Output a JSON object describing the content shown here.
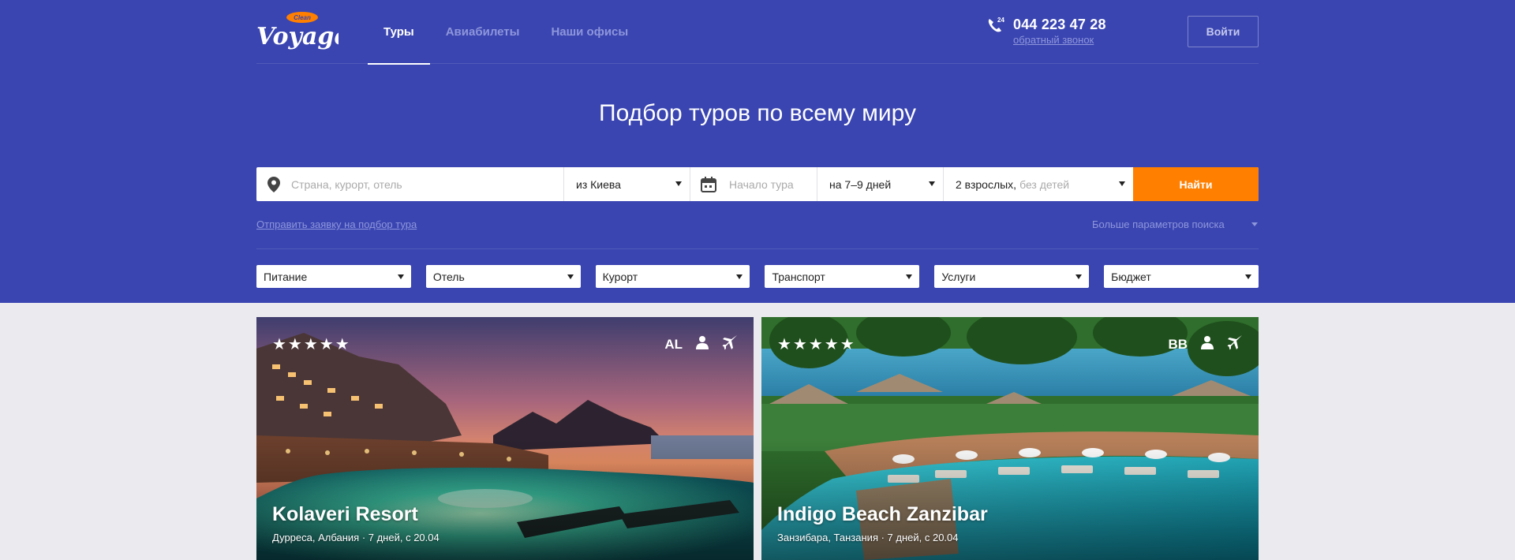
{
  "header": {
    "logo_text": "Voyage",
    "logo_badge": "Clean",
    "nav": [
      {
        "label": "Туры",
        "active": true
      },
      {
        "label": "Авиабилеты",
        "active": false
      },
      {
        "label": "Наши офисы",
        "active": false
      }
    ],
    "phone_badge": "24",
    "phone": "044 223 47 28",
    "callback_label": "обратный звонок",
    "login_label": "Войти"
  },
  "hero": {
    "title": "Подбор туров по всему миру"
  },
  "search": {
    "destination_placeholder": "Страна, курорт, отель",
    "from_value": "из Киева",
    "date_placeholder": "Начало тура",
    "duration_value": "на 7–9 дней",
    "guests_value": "2 взрослых,",
    "guests_children": "без детей",
    "find_label": "Найти"
  },
  "links": {
    "request_label": "Отправить заявку на подбор тура",
    "more_params_label": "Больше параметров поиска"
  },
  "filters": [
    "Питание",
    "Отель",
    "Курорт",
    "Транспорт",
    "Услуги",
    "Бюджет"
  ],
  "cards": [
    {
      "stars": "★★★★★",
      "meal": "AL",
      "title": "Kolaveri Resort",
      "subtitle": "Дурреса, Албания · 7 дней, с 20.04"
    },
    {
      "stars": "★★★★★",
      "meal": "BB",
      "title": "Indigo Beach Zanzibar",
      "subtitle": "Занзибара, Танзания · 7 дней, с 20.04"
    }
  ],
  "colors": {
    "hero_bg": "#3a45b1",
    "accent": "#ff7f00",
    "muted_link": "#8e96db",
    "page_bg": "#ebebef"
  }
}
